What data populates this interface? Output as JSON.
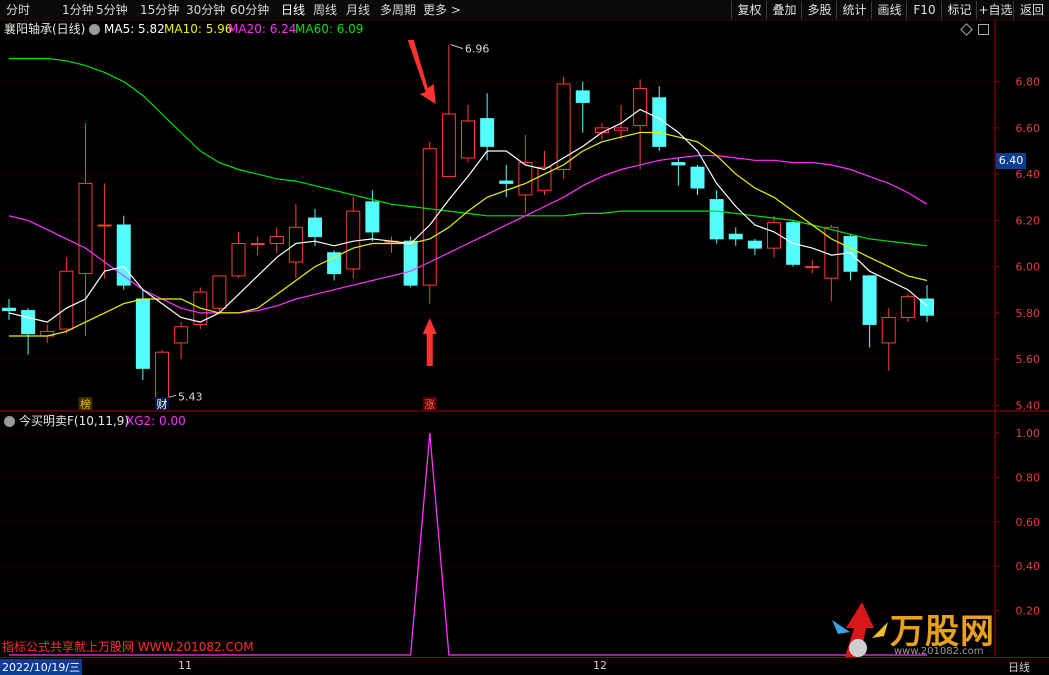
{
  "toolbar": {
    "periods": [
      "分时",
      "1分钟",
      "5分钟",
      "15分钟",
      "30分钟",
      "60分钟",
      "日线",
      "周线",
      "月线",
      "多周期",
      "更多 >"
    ],
    "active_period": "日线",
    "right_buttons": [
      "复权",
      "叠加",
      "多股",
      "统计",
      "画线",
      "F10",
      "标记",
      "+自选",
      "返回"
    ]
  },
  "main": {
    "stock_name": "襄阳轴承(日线)",
    "ma5": "MA5: 5.82",
    "ma10": "MA10: 5.96",
    "ma20": "MA20: 6.24",
    "ma60": "MA60: 6.09",
    "y_ticks": [
      "6.80",
      "6.60",
      "6.40",
      "6.20",
      "6.00",
      "5.80",
      "5.60",
      "5.40"
    ],
    "current_price_tag": "6.40",
    "high_label": "6.96",
    "low_label": "5.43",
    "badge_bang": "榜",
    "badge_cai": "财",
    "badge_zhang": "涨"
  },
  "indicator": {
    "title": "今买明卖F(10,11,9)",
    "xg2": "XG2: 0.00",
    "y_ticks": [
      "1.00",
      "0.80",
      "0.60",
      "0.40",
      "0.20"
    ]
  },
  "watermark": "指标公式共享就上万股网 WWW.201082.COM",
  "logo": {
    "name": "万股网",
    "url": "www.201082.com"
  },
  "dates": {
    "start": "2022/10/19/三",
    "m11": "11",
    "m12": "12",
    "period": "日线"
  },
  "colors": {
    "up": "#ff3b3b",
    "down": "#54fcfc",
    "ma5": "#ffffff",
    "ma10": "#f0f000",
    "ma20": "#ff30ff",
    "ma60": "#00e000"
  },
  "chart_data": {
    "type": "candlestick",
    "ylim": [
      5.38,
      6.98
    ],
    "candles": [
      {
        "o": 5.82,
        "c": 5.81,
        "h": 5.86,
        "l": 5.77
      },
      {
        "o": 5.81,
        "c": 5.71,
        "h": 5.82,
        "l": 5.62
      },
      {
        "o": 5.7,
        "c": 5.72,
        "h": 5.75,
        "l": 5.67
      },
      {
        "o": 5.73,
        "c": 5.98,
        "h": 6.04,
        "l": 5.71
      },
      {
        "o": 5.97,
        "c": 6.36,
        "h": 6.62,
        "l": 5.7
      },
      {
        "o": 6.18,
        "c": 6.18,
        "h": 6.36,
        "l": 5.95
      },
      {
        "o": 6.18,
        "c": 5.92,
        "h": 6.22,
        "l": 5.9
      },
      {
        "o": 5.86,
        "c": 5.56,
        "h": 5.9,
        "l": 5.51
      },
      {
        "o": 5.43,
        "c": 5.63,
        "h": 5.64,
        "l": 5.43
      },
      {
        "o": 5.67,
        "c": 5.74,
        "h": 5.76,
        "l": 5.6
      },
      {
        "o": 5.75,
        "c": 5.89,
        "h": 5.91,
        "l": 5.73
      },
      {
        "o": 5.82,
        "c": 5.96,
        "h": 5.96,
        "l": 5.8
      },
      {
        "o": 5.96,
        "c": 6.1,
        "h": 6.15,
        "l": 5.95
      },
      {
        "o": 6.1,
        "c": 6.1,
        "h": 6.13,
        "l": 6.05
      },
      {
        "o": 6.1,
        "c": 6.13,
        "h": 6.17,
        "l": 6.06
      },
      {
        "o": 6.02,
        "c": 6.17,
        "h": 6.27,
        "l": 5.95
      },
      {
        "o": 6.21,
        "c": 6.13,
        "h": 6.25,
        "l": 6.09
      },
      {
        "o": 6.06,
        "c": 5.97,
        "h": 6.07,
        "l": 5.94
      },
      {
        "o": 5.99,
        "c": 6.24,
        "h": 6.3,
        "l": 5.95
      },
      {
        "o": 6.28,
        "c": 6.15,
        "h": 6.33,
        "l": 6.11
      },
      {
        "o": 6.11,
        "c": 6.11,
        "h": 6.13,
        "l": 6.06
      },
      {
        "o": 6.11,
        "c": 5.92,
        "h": 6.13,
        "l": 5.91
      },
      {
        "o": 5.92,
        "c": 6.51,
        "h": 6.54,
        "l": 5.84
      },
      {
        "o": 6.39,
        "c": 6.66,
        "h": 6.96,
        "l": 6.39
      },
      {
        "o": 6.47,
        "c": 6.63,
        "h": 6.7,
        "l": 6.45
      },
      {
        "o": 6.64,
        "c": 6.52,
        "h": 6.75,
        "l": 6.46
      },
      {
        "o": 6.37,
        "c": 6.36,
        "h": 6.44,
        "l": 6.3
      },
      {
        "o": 6.31,
        "c": 6.45,
        "h": 6.57,
        "l": 6.23
      },
      {
        "o": 6.33,
        "c": 6.43,
        "h": 6.5,
        "l": 6.31
      },
      {
        "o": 6.42,
        "c": 6.79,
        "h": 6.82,
        "l": 6.38
      },
      {
        "o": 6.76,
        "c": 6.71,
        "h": 6.8,
        "l": 6.58
      },
      {
        "o": 6.58,
        "c": 6.6,
        "h": 6.62,
        "l": 6.55
      },
      {
        "o": 6.59,
        "c": 6.6,
        "h": 6.7,
        "l": 6.55
      },
      {
        "o": 6.61,
        "c": 6.77,
        "h": 6.81,
        "l": 6.42
      },
      {
        "o": 6.73,
        "c": 6.52,
        "h": 6.78,
        "l": 6.5
      },
      {
        "o": 6.45,
        "c": 6.44,
        "h": 6.47,
        "l": 6.35
      },
      {
        "o": 6.43,
        "c": 6.34,
        "h": 6.44,
        "l": 6.31
      },
      {
        "o": 6.29,
        "c": 6.12,
        "h": 6.33,
        "l": 6.1
      },
      {
        "o": 6.14,
        "c": 6.12,
        "h": 6.17,
        "l": 6.09
      },
      {
        "o": 6.11,
        "c": 6.08,
        "h": 6.12,
        "l": 6.05
      },
      {
        "o": 6.08,
        "c": 6.19,
        "h": 6.22,
        "l": 6.04
      },
      {
        "o": 6.19,
        "c": 6.01,
        "h": 6.2,
        "l": 6.0
      },
      {
        "o": 6.0,
        "c": 6.0,
        "h": 6.03,
        "l": 5.97
      },
      {
        "o": 5.95,
        "c": 6.17,
        "h": 6.18,
        "l": 5.85
      },
      {
        "o": 6.13,
        "c": 5.98,
        "h": 6.14,
        "l": 5.94
      },
      {
        "o": 5.96,
        "c": 5.75,
        "h": 5.96,
        "l": 5.65
      },
      {
        "o": 5.67,
        "c": 5.78,
        "h": 5.82,
        "l": 5.55
      },
      {
        "o": 5.78,
        "c": 5.87,
        "h": 5.88,
        "l": 5.76
      },
      {
        "o": 5.86,
        "c": 5.79,
        "h": 5.92,
        "l": 5.76
      }
    ],
    "ma5": [
      5.8,
      5.78,
      5.76,
      5.82,
      5.86,
      5.98,
      6.0,
      5.9,
      5.84,
      5.78,
      5.76,
      5.8,
      5.88,
      5.96,
      6.04,
      6.1,
      6.11,
      6.09,
      6.11,
      6.12,
      6.11,
      6.1,
      6.18,
      6.29,
      6.39,
      6.5,
      6.5,
      6.44,
      6.42,
      6.47,
      6.52,
      6.58,
      6.62,
      6.68,
      6.64,
      6.58,
      6.5,
      6.36,
      6.26,
      6.18,
      6.15,
      6.1,
      6.08,
      6.05,
      6.06,
      5.98,
      5.94,
      5.9,
      5.83
    ],
    "ma10": [
      5.7,
      5.7,
      5.7,
      5.72,
      5.76,
      5.8,
      5.84,
      5.86,
      5.86,
      5.86,
      5.82,
      5.8,
      5.8,
      5.82,
      5.88,
      5.94,
      6.0,
      6.04,
      6.08,
      6.1,
      6.1,
      6.1,
      6.12,
      6.17,
      6.24,
      6.3,
      6.33,
      6.36,
      6.4,
      6.44,
      6.5,
      6.54,
      6.56,
      6.58,
      6.58,
      6.56,
      6.54,
      6.48,
      6.4,
      6.34,
      6.3,
      6.24,
      6.18,
      6.12,
      6.08,
      6.04,
      6.0,
      5.96,
      5.94
    ],
    "ma20": [
      6.22,
      6.2,
      6.16,
      6.12,
      6.08,
      6.02,
      5.96,
      5.9,
      5.86,
      5.82,
      5.8,
      5.8,
      5.8,
      5.81,
      5.83,
      5.86,
      5.88,
      5.9,
      5.92,
      5.94,
      5.96,
      5.98,
      6.02,
      6.06,
      6.1,
      6.14,
      6.18,
      6.22,
      6.26,
      6.3,
      6.35,
      6.39,
      6.42,
      6.44,
      6.46,
      6.47,
      6.48,
      6.48,
      6.47,
      6.46,
      6.46,
      6.45,
      6.45,
      6.44,
      6.42,
      6.39,
      6.36,
      6.32,
      6.27
    ],
    "ma60": [
      6.9,
      6.9,
      6.9,
      6.89,
      6.87,
      6.84,
      6.8,
      6.74,
      6.66,
      6.58,
      6.5,
      6.45,
      6.42,
      6.4,
      6.38,
      6.37,
      6.35,
      6.33,
      6.31,
      6.29,
      6.27,
      6.26,
      6.25,
      6.24,
      6.23,
      6.22,
      6.22,
      6.22,
      6.22,
      6.22,
      6.23,
      6.23,
      6.24,
      6.24,
      6.24,
      6.24,
      6.24,
      6.24,
      6.23,
      6.22,
      6.21,
      6.2,
      6.18,
      6.16,
      6.14,
      6.12,
      6.11,
      6.1,
      6.09
    ],
    "indicator_signal": {
      "index": 22,
      "value": 1.0
    },
    "indicator_ylim": [
      0.0,
      1.0
    ]
  }
}
